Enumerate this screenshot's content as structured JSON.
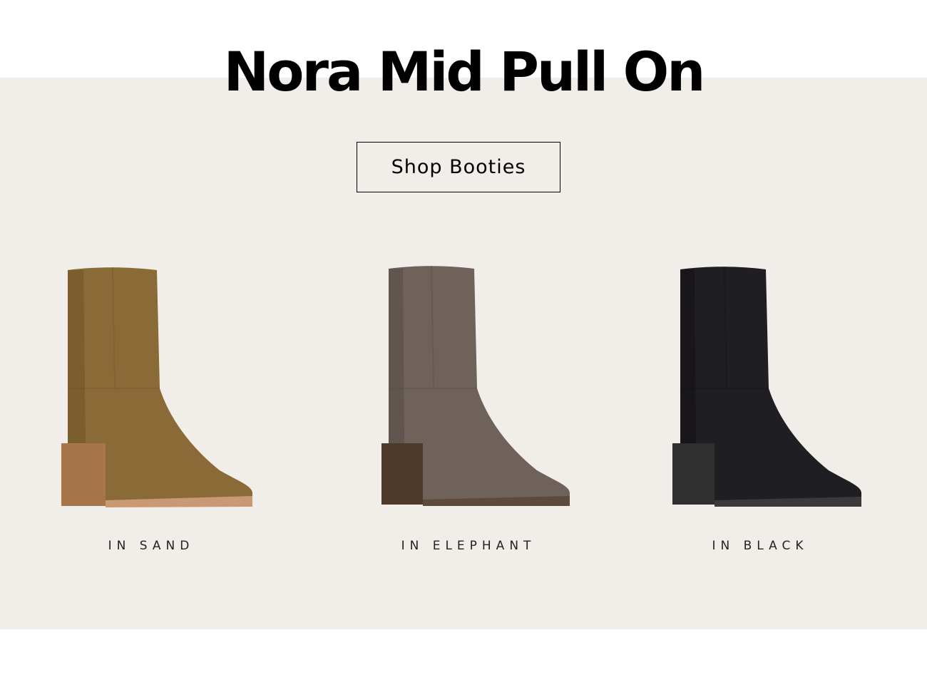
{
  "header": {
    "title": "Nora Mid Pull On"
  },
  "cta": {
    "label": "Shop Booties"
  },
  "products": [
    {
      "label": "IN SAND",
      "color_shaft": "#8a6b37",
      "color_shadow": "#6f5427",
      "color_heel": "#a8744a",
      "color_sole": "#c99874"
    },
    {
      "label": "IN ELEPHANT",
      "color_shaft": "#6e625b",
      "color_shadow": "#574c46",
      "color_heel": "#4d3a2b",
      "color_sole": "#5c4a3c"
    },
    {
      "label": "IN BLACK",
      "color_shaft": "#1f1e22",
      "color_shadow": "#121114",
      "color_heel": "#2f2f30",
      "color_sole": "#3a3a3b"
    }
  ],
  "colors": {
    "panel_background": "#f1eeea",
    "page_background": "#ffffff",
    "text": "#000000"
  }
}
